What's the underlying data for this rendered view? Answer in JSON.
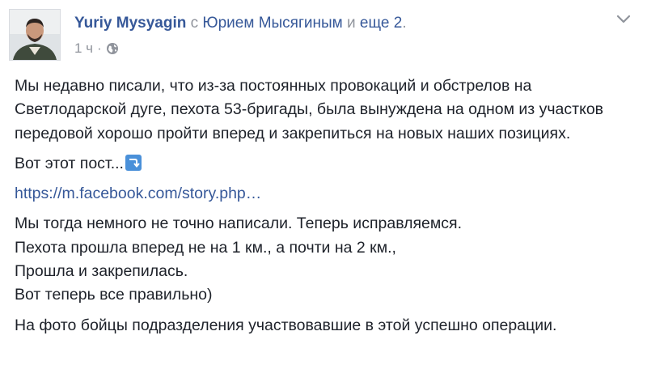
{
  "post": {
    "author": "Yuriy Mysyagin",
    "with_word": "с",
    "with_name": "Юрием Мысягиным",
    "and_word": "и",
    "others": "еще 2",
    "period": ".",
    "time": "1 ч",
    "dot": "·",
    "paragraph1": "Мы недавно писали, что из-за постоянных провокаций и обстрелов на Светлодарской дуге, пехота 53-бригады, была вынуждена на одном из участков передовой хорошо пройти вперед и закрепиться на новых наших позициях.",
    "paragraph2": "Вот этот пост...",
    "link": "https://m.facebook.com/story.php…",
    "paragraph3_lines": [
      "Мы тогда немного не точно написали. Теперь исправляемся.",
      "Пехота прошла вперед не на 1 км., а почти на 2 км.,",
      "Прошла и закрепилась.",
      "Вот теперь все правильно)"
    ],
    "paragraph4": "На фото бойцы подразделения участвовавшие в этой успешно операции."
  },
  "icons": {
    "globe": "globe-icon",
    "chevron": "chevron-down-icon",
    "emoji": "arrow-right-hook-down-emoji"
  },
  "colors": {
    "link": "#365899",
    "meta": "#90949c",
    "text": "#1d2129",
    "emoji_bg": "#4a90d9"
  }
}
